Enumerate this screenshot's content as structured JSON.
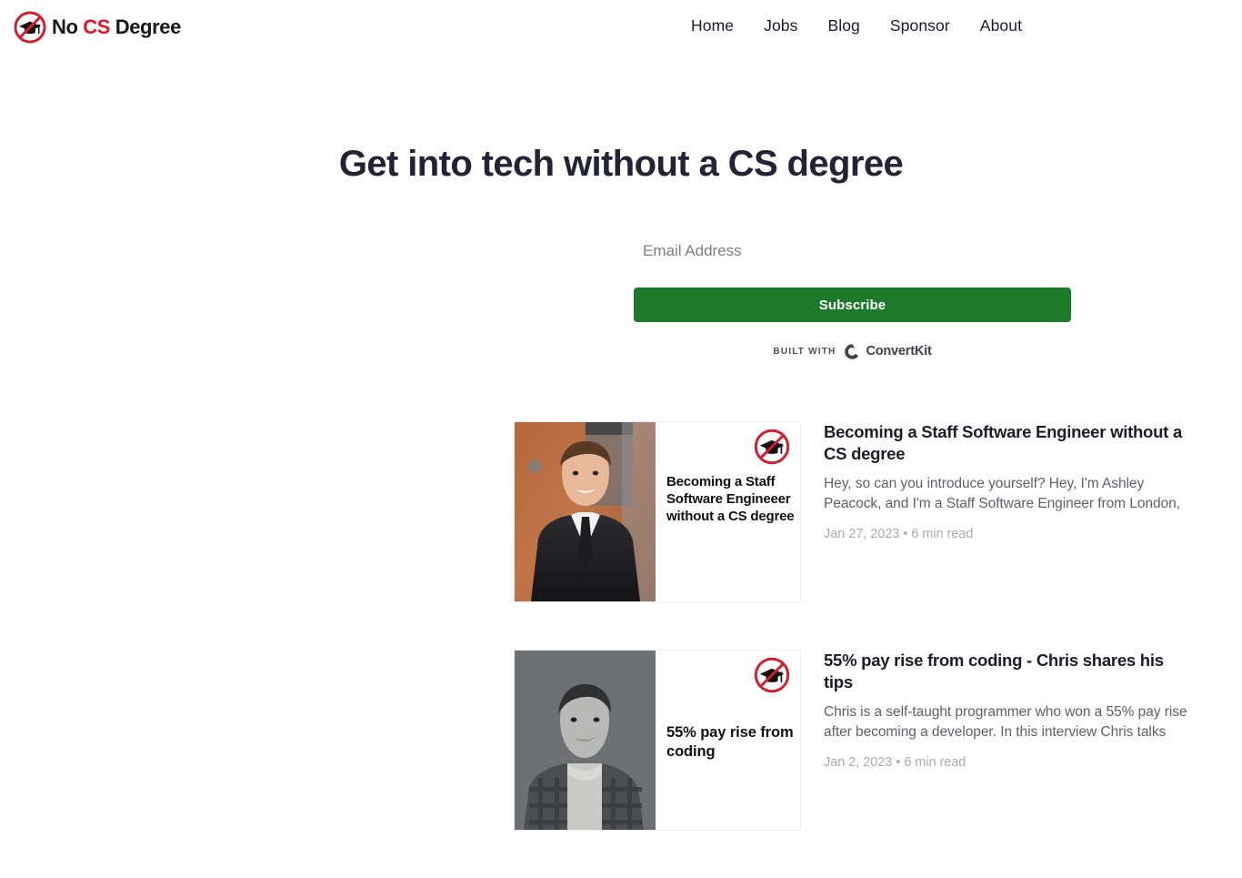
{
  "header": {
    "brand": {
      "text_1": "No",
      "text_cs": "CS",
      "text_2": "Degree",
      "icon": "no-cs-degree-logo-icon"
    },
    "nav": [
      {
        "label": "Home"
      },
      {
        "label": "Jobs"
      },
      {
        "label": "Blog"
      },
      {
        "label": "Sponsor"
      },
      {
        "label": "About"
      }
    ]
  },
  "hero": {
    "title": "Get into tech without a CS degree"
  },
  "signup": {
    "email_placeholder": "Email Address",
    "email_value": "",
    "subscribe_label": "Subscribe",
    "built_with_label": "BUILT WITH",
    "provider_name": "ConvertKit",
    "provider_icon": "convertkit-logo-icon",
    "button_color": "#1d7a2a"
  },
  "articles": [
    {
      "thumb_headline": "Becoming a Staff Software Engineeer without a CS degree",
      "thumb_badge_icon": "no-cs-degree-badge-icon",
      "title": "Becoming a Staff Software Engineer without a CS degree",
      "excerpt": "Hey, so can you introduce yourself? Hey, I'm Ashley Peacock, and I'm a Staff Software Engineer from London,",
      "date": "Jan 27, 2023",
      "read_time": "6 min read",
      "photo_style": "color-portrait-brick-wall"
    },
    {
      "thumb_headline": "55% pay rise from coding",
      "thumb_badge_icon": "no-cs-degree-badge-icon",
      "title": "55% pay rise from coding - Chris shares his tips",
      "excerpt": "Chris is a self-taught programmer who won a 55% pay rise after becoming a developer. In this interview Chris talks",
      "date": "Jan 2, 2023",
      "read_time": "6 min read",
      "photo_style": "grayscale-portrait-gray-bg"
    }
  ],
  "separator": "•"
}
